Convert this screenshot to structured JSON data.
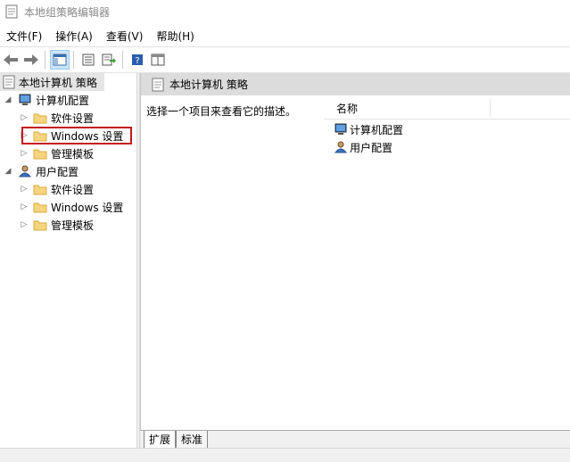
{
  "window": {
    "title": "本地组策略编辑器"
  },
  "menu": [
    "文件(F)",
    "操作(A)",
    "查看(V)",
    "帮助(H)"
  ],
  "toolbar": {
    "buttons": [
      "back-icon",
      "forward-icon",
      "show-hide-tree-icon",
      "properties-icon",
      "export-list-icon",
      "help-icon",
      "view-icon"
    ]
  },
  "tree": {
    "root": "本地计算机 策略",
    "computer_config": "计算机配置",
    "computer_children": [
      "软件设置",
      "Windows 设置",
      "管理模板"
    ],
    "user_config": "用户配置",
    "user_children": [
      "软件设置",
      "Windows 设置",
      "管理模板"
    ]
  },
  "right": {
    "header": "本地计算机 策略",
    "description": "选择一个项目来查看它的描述。",
    "column_name": "名称",
    "items": [
      "计算机配置",
      "用户配置"
    ]
  },
  "tabs": [
    "扩展",
    "标准"
  ],
  "colors": {
    "highlight_border": "#c4171d",
    "selected_tab_bg": "#cce4f7"
  }
}
